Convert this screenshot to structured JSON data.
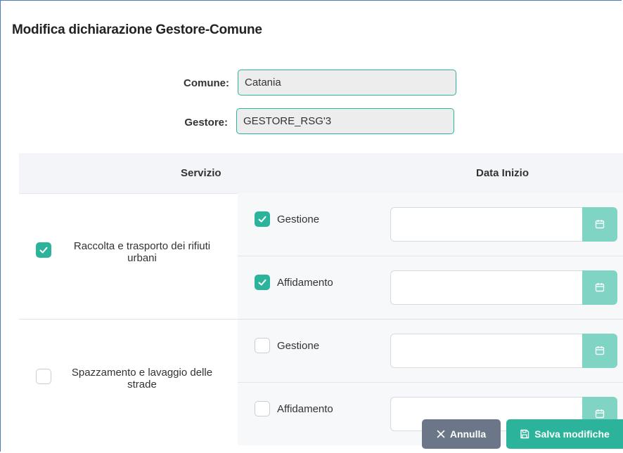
{
  "dialog": {
    "title": "Modifica dichiarazione Gestore-Comune"
  },
  "form": {
    "comune_label": "Comune:",
    "comune_value": "Catania",
    "gestore_label": "Gestore:",
    "gestore_value": "GESTORE_RSG'3"
  },
  "table": {
    "headers": [
      "Servizio",
      "Data Inizio"
    ],
    "rows": [
      {
        "service": "Raccolta e trasporto dei rifiuti urbani",
        "service_line1": "Raccolta e trasporto dei rifiuti",
        "service_line2": "urbani",
        "checked": true,
        "options": [
          {
            "label": "Gestione",
            "checked": true,
            "date": ""
          },
          {
            "label": "Affidamento",
            "checked": true,
            "date": ""
          }
        ]
      },
      {
        "service": "Spazzamento e lavaggio delle strade",
        "service_line1": "Spazzamento e lavaggio delle",
        "service_line2": "strade",
        "checked": false,
        "options": [
          {
            "label": "Gestione",
            "checked": false,
            "date": ""
          },
          {
            "label": "Affidamento",
            "checked": false,
            "date": ""
          }
        ]
      }
    ]
  },
  "actions": {
    "cancel_label": "Annulla",
    "save_label": "Salva modifiche"
  },
  "colors": {
    "accent": "#2bb49b",
    "accent_light": "#7fd4c4",
    "cancel": "#6b7788"
  },
  "icons": {
    "check": "check-icon",
    "calendar": "calendar-icon",
    "cancel": "close-icon",
    "save": "save-icon"
  }
}
